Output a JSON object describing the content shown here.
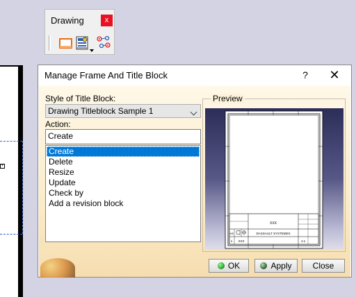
{
  "toolbar": {
    "title": "Drawing",
    "close_glyph": "x",
    "icons": [
      "frame-sheet-icon",
      "title-block-icon",
      "view-links-icon"
    ]
  },
  "dialog": {
    "title": "Manage Frame And Title Block",
    "help_glyph": "?",
    "close_glyph": "✕",
    "style_label": "Style of Title Block:",
    "style_value": "Drawing Titleblock Sample 1",
    "action_label": "Action:",
    "action_value": "Create",
    "actions": [
      "Create",
      "Delete",
      "Resize",
      "Update",
      "Check by",
      "Add a revision block"
    ],
    "selected_action": "Create",
    "preview_label": "Preview",
    "preview_sheet": {
      "title_cell": "XXX",
      "company": "DASSAULT SYSTEMES",
      "format": "A4",
      "sheet_no": "1",
      "drawing_no": "XXX",
      "scale": "1:1"
    },
    "buttons": {
      "ok": "OK",
      "apply": "Apply",
      "close": "Close"
    }
  },
  "colors": {
    "selection": "#0078d7",
    "close_button": "#e81123",
    "ok_dot": "#2fa82f",
    "apply_dot": "#3a6e3a",
    "canvas_background": "#d3d3e3"
  }
}
